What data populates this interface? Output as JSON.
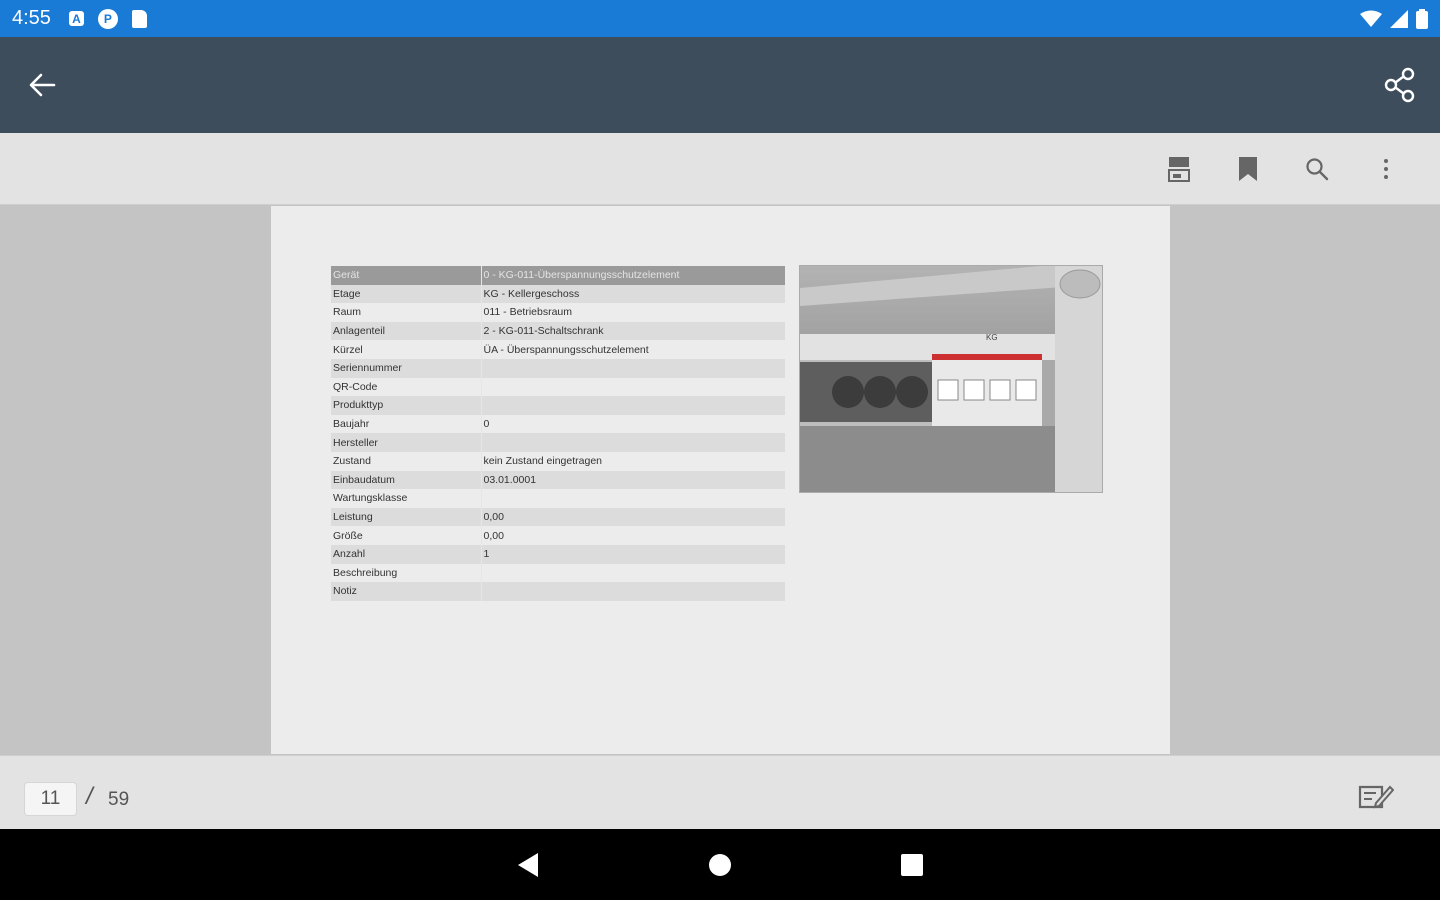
{
  "status_bar": {
    "time": "4:55",
    "icons": [
      "a-notification-icon",
      "p-notification-icon",
      "sd-card-icon",
      "wifi-icon",
      "signal-icon",
      "battery-icon"
    ],
    "notif_a": "A",
    "notif_p": "P"
  },
  "app_bar": {
    "color": "#3d4d5c",
    "icons": [
      "back-arrow-icon",
      "share-icon"
    ]
  },
  "toolbar": {
    "icons": [
      "view-mode-icon",
      "bookmark-icon",
      "search-icon",
      "more-vert-icon"
    ]
  },
  "document": {
    "header": {
      "key": "Gerät",
      "value": "0 - KG-011-Überspannungsschutzelement"
    },
    "rows": [
      {
        "key": "Etage",
        "value": "KG - Kellergeschoss"
      },
      {
        "key": "Raum",
        "value": "011 - Betriebsraum"
      },
      {
        "key": "Anlagenteil",
        "value": "2 - KG-011-Schaltschrank"
      },
      {
        "key": "Kürzel",
        "value": "ÜA - Überspannungsschutzelement"
      },
      {
        "key": "Seriennummer",
        "value": ""
      },
      {
        "key": "QR-Code",
        "value": ""
      },
      {
        "key": "Produkttyp",
        "value": ""
      },
      {
        "key": "Baujahr",
        "value": "0"
      },
      {
        "key": "Hersteller",
        "value": ""
      },
      {
        "key": "Zustand",
        "value": "kein Zustand eingetragen"
      },
      {
        "key": "Einbaudatum",
        "value": "03.01.0001"
      },
      {
        "key": "Wartungsklasse",
        "value": ""
      },
      {
        "key": "Leistung",
        "value": "0,00"
      },
      {
        "key": "Größe",
        "value": "0,00"
      },
      {
        "key": "Anzahl",
        "value": "1"
      },
      {
        "key": "Beschreibung",
        "value": ""
      },
      {
        "key": "Notiz",
        "value": ""
      }
    ],
    "photo_label": "KG"
  },
  "pagination": {
    "current": "11",
    "separator": "/",
    "total": "59"
  },
  "nav_bar": {
    "icons": [
      "nav-back-icon",
      "nav-home-icon",
      "nav-recents-icon"
    ]
  }
}
